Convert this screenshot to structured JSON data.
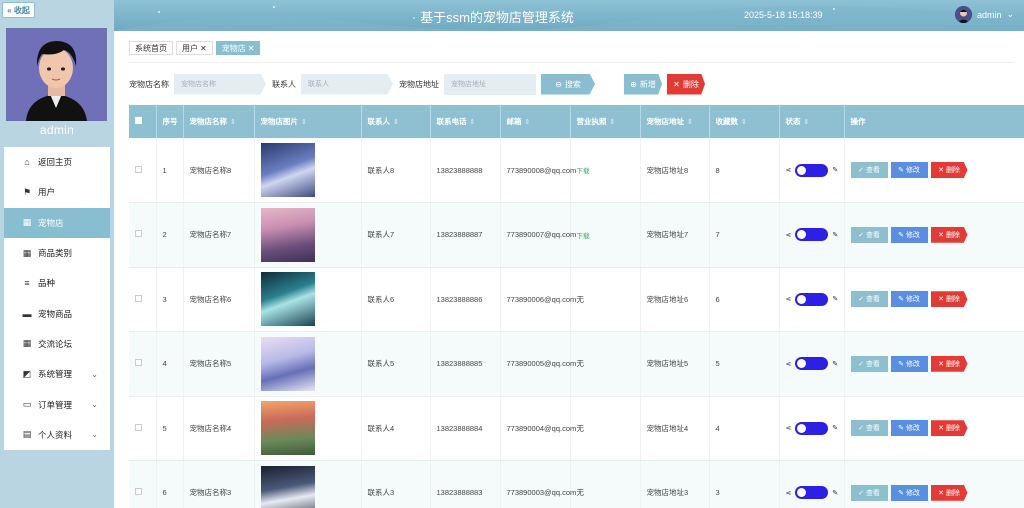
{
  "sidebar": {
    "collapse_label": "« 收起",
    "username": "admin",
    "items": [
      {
        "label": "返回主页",
        "icon": "home-icon",
        "glyph": "⌂"
      },
      {
        "label": "用户",
        "icon": "flag-icon",
        "glyph": "⚑"
      },
      {
        "label": "宠物店",
        "icon": "grid-icon",
        "glyph": "▦"
      },
      {
        "label": "商品类别",
        "icon": "grid-icon",
        "glyph": "▦"
      },
      {
        "label": "品种",
        "icon": "sliders-icon",
        "glyph": "≡"
      },
      {
        "label": "宠物商品",
        "icon": "ticket-icon",
        "glyph": "▬"
      },
      {
        "label": "交流论坛",
        "icon": "grid-icon",
        "glyph": "▦"
      },
      {
        "label": "系统管理",
        "icon": "chart-icon",
        "glyph": "◩"
      },
      {
        "label": "订单管理",
        "icon": "monitor-icon",
        "glyph": "▭"
      },
      {
        "label": "个人资料",
        "icon": "card-icon",
        "glyph": "▤"
      }
    ]
  },
  "header": {
    "title": "基于ssm的宠物店管理系统",
    "time": "2025-5-18 15:18:39",
    "username": "admin"
  },
  "tabs": [
    {
      "label": "系统首页",
      "closable": false
    },
    {
      "label": "用户",
      "closable": true
    },
    {
      "label": "宠物店",
      "closable": true
    }
  ],
  "search": {
    "name_label": "宠物店名称",
    "name_placeholder": "宠物店名称",
    "contact_label": "联系人",
    "contact_placeholder": "联系人",
    "address_label": "宠物店地址",
    "address_placeholder": "宠物店地址",
    "search_button": "搜索",
    "add_button": "新增",
    "delete_button": "删除"
  },
  "table": {
    "headers": [
      "序号",
      "宠物店名称",
      "宠物店图片",
      "联系人",
      "联系电话",
      "邮箱",
      "营业执照",
      "宠物店地址",
      "收藏数",
      "状态",
      "操作"
    ],
    "rows": [
      {
        "index": "1",
        "name": "宠物店名称8",
        "contact": "联系人8",
        "phone": "13823888888",
        "email": "773890008@qq.com",
        "license": "下载",
        "address": "宠物店地址8",
        "favorites": "8"
      },
      {
        "index": "2",
        "name": "宠物店名称7",
        "contact": "联系人7",
        "phone": "13823888887",
        "email": "773890007@qq.com",
        "license": "下载",
        "address": "宠物店地址7",
        "favorites": "7"
      },
      {
        "index": "3",
        "name": "宠物店名称6",
        "contact": "联系人6",
        "phone": "13823888886",
        "email": "773890006@qq.com",
        "license": "无",
        "address": "宠物店地址6",
        "favorites": "6"
      },
      {
        "index": "4",
        "name": "宠物店名称5",
        "contact": "联系人5",
        "phone": "13823888885",
        "email": "773890005@qq.com",
        "license": "无",
        "address": "宠物店地址5",
        "favorites": "5"
      },
      {
        "index": "5",
        "name": "宠物店名称4",
        "contact": "联系人4",
        "phone": "13823888884",
        "email": "773890004@qq.com",
        "license": "无",
        "address": "宠物店地址4",
        "favorites": "4"
      },
      {
        "index": "6",
        "name": "宠物店名称3",
        "contact": "联系人3",
        "phone": "13823888883",
        "email": "773890003@qq.com",
        "license": "无",
        "address": "宠物店地址3",
        "favorites": "3"
      }
    ],
    "actions": {
      "view": "查看",
      "edit": "修改",
      "delete": "删除"
    }
  },
  "colors": {
    "accent": "#89bed0",
    "danger": "#e23b36",
    "edit": "#5a8ee0",
    "toggle": "#2d1fe3"
  }
}
